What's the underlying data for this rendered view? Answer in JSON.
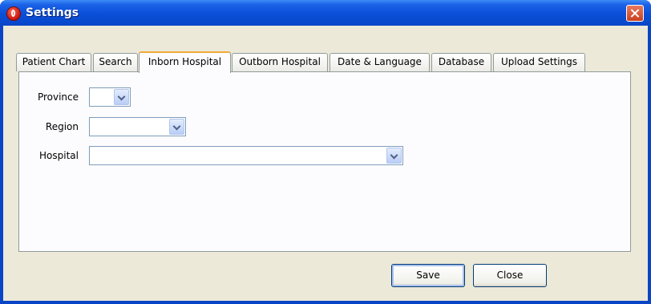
{
  "window": {
    "title": "Settings",
    "icon": "app-icon",
    "close_icon": "close-icon"
  },
  "tabs": [
    {
      "label": "Patient Chart",
      "active": false
    },
    {
      "label": "Search",
      "active": false
    },
    {
      "label": "Inborn Hospital",
      "active": true
    },
    {
      "label": "Outborn Hospital",
      "active": false
    },
    {
      "label": "Date & Language",
      "active": false
    },
    {
      "label": "Database",
      "active": false
    },
    {
      "label": "Upload Settings",
      "active": false
    }
  ],
  "form": {
    "province": {
      "label": "Province",
      "value": ""
    },
    "region": {
      "label": "Region",
      "value": ""
    },
    "hospital": {
      "label": "Hospital",
      "value": ""
    }
  },
  "buttons": {
    "save": "Save",
    "close": "Close"
  },
  "colors": {
    "title_bar": "#0a4fd8",
    "active_tab_accent": "#f0a93a",
    "dialog_bg": "#ece9d8"
  }
}
